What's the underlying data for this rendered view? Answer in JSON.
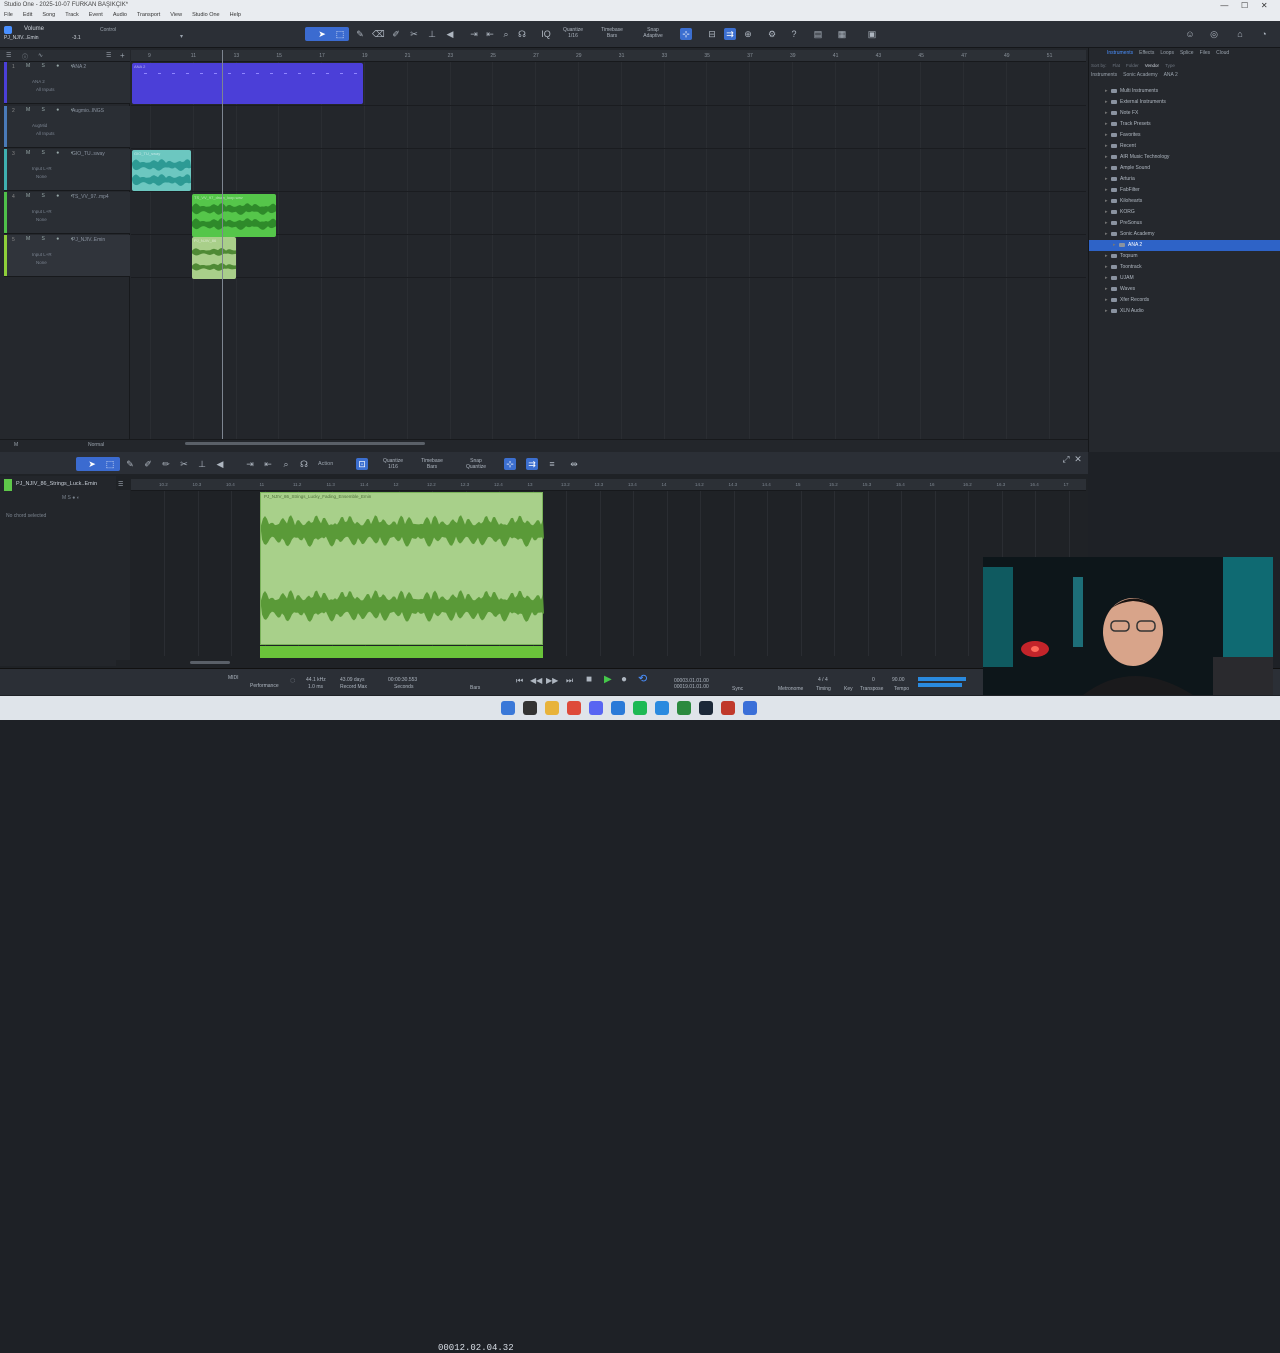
{
  "window": {
    "title": "Studio One - 2025-10-07 FURKAN BAŞIKÇIK*",
    "controls": [
      "—",
      "☐",
      "✕"
    ]
  },
  "menu": [
    "File",
    "Edit",
    "Song",
    "Track",
    "Event",
    "Audio",
    "Transport",
    "View",
    "Studio One",
    "Help"
  ],
  "toolbar": {
    "volume_label": "Volume",
    "track_label": "PJ_NJIV...Emin",
    "volume_value": "-3.1",
    "control_label": "Control",
    "quantize_label": "Quantize",
    "quantize_value": "1/16",
    "timebase_label": "Timebase",
    "timebase_value": "Bars",
    "snap_label": "Snap",
    "snap_value": "Adaptive"
  },
  "ruler": [
    "9",
    "11",
    "13",
    "15",
    "17",
    "19",
    "21",
    "23",
    "25",
    "27",
    "29",
    "31",
    "33",
    "35",
    "37",
    "39",
    "41",
    "43",
    "45",
    "47",
    "49",
    "51"
  ],
  "tracks": [
    {
      "num": "1",
      "name": "ANA 2",
      "io": "ANA 2",
      "io2": "All Inputs",
      "color": "#4b3fd8"
    },
    {
      "num": "2",
      "name": "Augmio..INGS",
      "io": "AugMid",
      "io2": "All Inputs",
      "color": "#4a7ab8"
    },
    {
      "num": "3",
      "name": "GIO_TU..sway",
      "io": "Input L+R",
      "io2": "None",
      "color": "#3fb0b0"
    },
    {
      "num": "4",
      "name": "TS_VV_97..mp4",
      "io": "Input L+R",
      "io2": "None",
      "color": "#4fc04a"
    },
    {
      "num": "5",
      "name": "PJ_NJIV..Emin",
      "io": "Input L+R",
      "io2": "None",
      "color": "#8fcf3a"
    }
  ],
  "msrc": "M S ● ◐",
  "clips": [
    {
      "name": "ANA 2",
      "color": "#4b3fd8"
    },
    {
      "name": "GIO_TU_sway",
      "color": "#6cc7c0"
    },
    {
      "name": "TS_VV_97_drum_loop.wav",
      "color": "#55c64a"
    },
    {
      "name": "PJ_NJIV_86",
      "color": "#a9cf8a"
    }
  ],
  "arr_footer": {
    "left": "M",
    "mode": "Normal"
  },
  "browser": {
    "tabs": [
      "Instruments",
      "Effects",
      "Loops",
      "Splice",
      "Files",
      "Cloud"
    ],
    "filters": [
      "Sort by:",
      "Flat",
      "Folder",
      "Vendor",
      "Type"
    ],
    "crumbs": [
      "Instruments",
      "Sonic Academy",
      "ANA 2"
    ],
    "items": [
      {
        "label": "Multi Instruments",
        "level": 1
      },
      {
        "label": "External Instruments",
        "level": 1
      },
      {
        "label": "Note FX",
        "level": 1
      },
      {
        "label": "Track Presets",
        "level": 1
      },
      {
        "label": "Favorites",
        "level": 1
      },
      {
        "label": "Recent",
        "level": 1
      },
      {
        "label": "AIR Music Technology",
        "level": 1
      },
      {
        "label": "Ample Sound",
        "level": 1
      },
      {
        "label": "Arturia",
        "level": 1
      },
      {
        "label": "FabFilter",
        "level": 1
      },
      {
        "label": "Kilohearts",
        "level": 1
      },
      {
        "label": "KORG",
        "level": 1
      },
      {
        "label": "PreSonus",
        "level": 1
      },
      {
        "label": "Sonic Academy",
        "level": 1
      },
      {
        "label": "ANA 2",
        "level": 2,
        "selected": true
      },
      {
        "label": "Toqsum",
        "level": 1
      },
      {
        "label": "Toontrack",
        "level": 1
      },
      {
        "label": "UJAM",
        "level": 1
      },
      {
        "label": "Waves",
        "level": 1
      },
      {
        "label": "Xfer Records",
        "level": 1
      },
      {
        "label": "XLN Audio",
        "level": 1
      }
    ]
  },
  "editor": {
    "action_label": "Action",
    "quantize_label": "Quantize",
    "quantize_value": "1/16",
    "timebase_label": "Timebase",
    "timebase_value": "Bars",
    "snap_label": "Snap",
    "snap_value": "Quantize",
    "track_name": "PJ_NJIV_86_Strings_Luck..Emin",
    "no_chord": "No chord selected",
    "clip_name": "PJ_NJIV_86_Strings_Lucky_Fading_Ensemble_Emin",
    "ruler": [
      "10.2",
      "10.3",
      "10.4",
      "11",
      "11.2",
      "11.3",
      "11.4",
      "12",
      "12.2",
      "12.3",
      "12.4",
      "13",
      "13.2",
      "13.3",
      "13.4",
      "14",
      "14.2",
      "14.3",
      "14.4",
      "15",
      "15.2",
      "15.3",
      "15.4",
      "16",
      "16.2",
      "16.3",
      "16.4",
      "17"
    ]
  },
  "transport": {
    "midi": "MIDI",
    "performance": "Performance",
    "sample_rate": "44.1 kHz",
    "latency": "1.0 ms",
    "record_max": "43.09 days",
    "record_max_label": "Record Max",
    "seconds_val": "00:00:30.553",
    "seconds_label": "Seconds",
    "time_main": "00012.02.04.32",
    "time_unit": "Bars",
    "loop_start": "00003.01.01.00",
    "loop_end": "00019.01.01.00",
    "sync": "Sync",
    "metronome": "Metronome",
    "signature": "4 / 4",
    "timing": "Timing",
    "key": "Key",
    "transpose_val": "0",
    "transpose_label": "Transpose",
    "tempo_val": "90.00",
    "tempo_label": "Tempo"
  },
  "taskbar": [
    "start",
    "search",
    "explorer",
    "chrome",
    "discord",
    "vscode",
    "spotify",
    "edge",
    "xbox",
    "steam",
    "tool",
    "studio-one"
  ]
}
